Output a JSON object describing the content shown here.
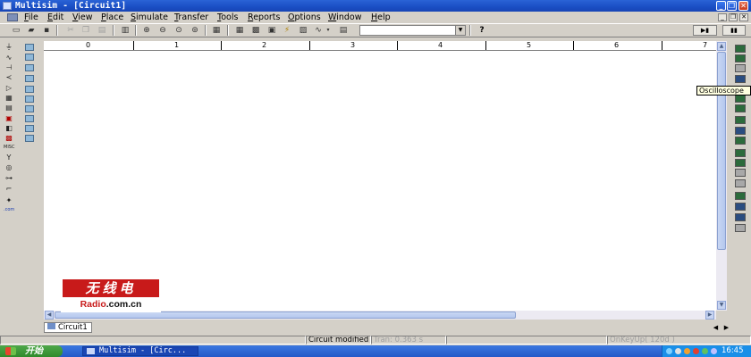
{
  "window": {
    "title": "Multisim - [Circuit1]"
  },
  "menu": [
    {
      "label": "File",
      "hot": "F",
      "rest": "ile"
    },
    {
      "label": "Edit",
      "hot": "E",
      "rest": "dit"
    },
    {
      "label": "View",
      "hot": "V",
      "rest": "iew"
    },
    {
      "label": "Place",
      "hot": "P",
      "rest": "lace"
    },
    {
      "label": "Simulate",
      "hot": "S",
      "rest": "imulate"
    },
    {
      "label": "Transfer",
      "hot": "T",
      "rest": "ransfer"
    },
    {
      "label": "Tools",
      "hot": "T",
      "rest": "ools"
    },
    {
      "label": "Reports",
      "hot": "R",
      "rest": "eports"
    },
    {
      "label": "Options",
      "hot": "O",
      "rest": "ptions"
    },
    {
      "label": "Window",
      "hot": "W",
      "rest": "indow"
    },
    {
      "label": "Help",
      "hot": "H",
      "rest": "elp"
    }
  ],
  "ruler": {
    "labels": [
      "0",
      "1",
      "2",
      "3",
      "4",
      "5",
      "6",
      "7"
    ]
  },
  "logo": {
    "chinese": "无线电",
    "url_main": "Radio",
    "url_tail": ".com.cn"
  },
  "tooltip": "Oscilloscope",
  "tabs": [
    "Circuit1"
  ],
  "status": {
    "main": "Circuit modified",
    "tran": "Tran: 0.363 s",
    "key": "OnKeyUp( 120d )"
  },
  "taskbar": {
    "start": "开始",
    "task_button": "Multisim - [Circ...",
    "clock": "16:45"
  },
  "colors": {
    "titlebar": "#1a4ec4",
    "canvas": "#ffffff",
    "logo_red": "#c81a1a",
    "taskbar": "#2459c8",
    "start_green": "#2f8a2b"
  }
}
